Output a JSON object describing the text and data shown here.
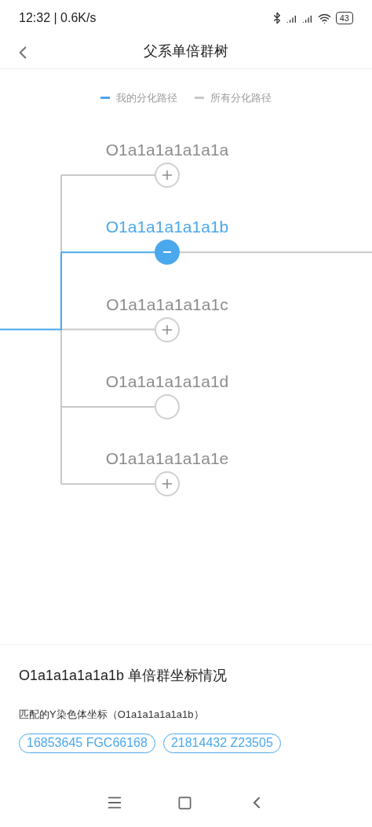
{
  "status_bar": {
    "time": "12:32 | 0.6K/s",
    "battery": "43"
  },
  "header": {
    "title": "父系单倍群树"
  },
  "legend": [
    {
      "label": "我的分化路径",
      "color": "#4aa8ec"
    },
    {
      "label": "所有分化路径",
      "color": "#c8c8c8"
    }
  ],
  "tree": {
    "nodes": [
      {
        "label": "O1a1a1a1a1a1a",
        "kind": "expandable",
        "selected": false,
        "expanded": false
      },
      {
        "label": "O1a1a1a1a1a1b",
        "kind": "expandable",
        "selected": true,
        "expanded": true
      },
      {
        "label": "O1a1a1a1a1a1c",
        "kind": "expandable",
        "selected": false,
        "expanded": false
      },
      {
        "label": "O1a1a1a1a1a1d",
        "kind": "leaf",
        "selected": false,
        "expanded": false
      },
      {
        "label": "O1a1a1a1a1a1e",
        "kind": "expandable",
        "selected": false,
        "expanded": false
      }
    ]
  },
  "details": {
    "title": "O1a1a1a1a1a1b 单倍群坐标情况",
    "subtitle": "匹配的Y染色体坐标（O1a1a1a1a1a1b）",
    "chips": [
      "16853645 FGC66168",
      "21814432 Z23505"
    ]
  }
}
